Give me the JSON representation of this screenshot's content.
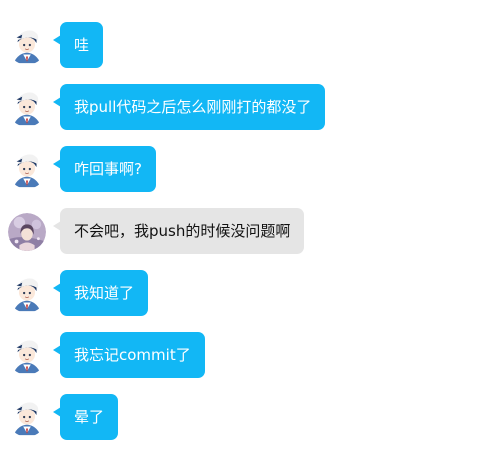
{
  "messages": [
    {
      "text": "哇",
      "sender": "me",
      "avatar_icon": "cartoon-boy-avatar-icon"
    },
    {
      "text": "我pull代码之后怎么刚刚打的都没了",
      "sender": "me",
      "avatar_icon": "cartoon-boy-avatar-icon"
    },
    {
      "text": "咋回事啊?",
      "sender": "me",
      "avatar_icon": "cartoon-boy-avatar-icon"
    },
    {
      "text": "不会吧，我push的时候没问题啊",
      "sender": "friend",
      "avatar_icon": "girl-photo-avatar-icon"
    },
    {
      "text": "我知道了",
      "sender": "me",
      "avatar_icon": "cartoon-boy-avatar-icon"
    },
    {
      "text": "我忘记commit了",
      "sender": "me",
      "avatar_icon": "cartoon-boy-avatar-icon"
    },
    {
      "text": "晕了",
      "sender": "me",
      "avatar_icon": "cartoon-boy-avatar-icon"
    }
  ],
  "colors": {
    "my_bubble": "#12b7f5",
    "friend_bubble": "#e5e5e5"
  }
}
